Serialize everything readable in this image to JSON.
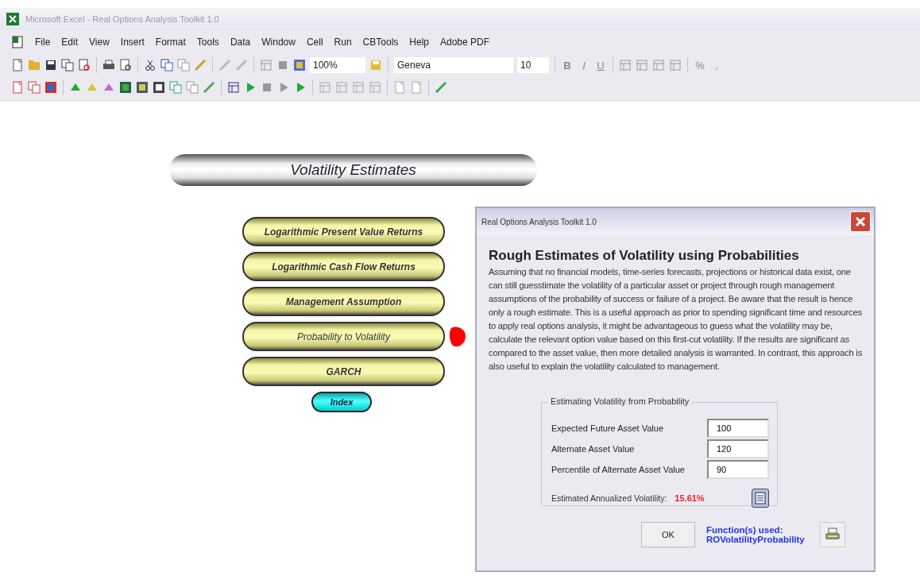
{
  "window": {
    "title": "Microsoft Excel - Real Options Analysis Toolkit 1.0"
  },
  "menu": [
    "File",
    "Edit",
    "View",
    "Insert",
    "Format",
    "Tools",
    "Data",
    "Window",
    "Cell",
    "Run",
    "CBTools",
    "Help",
    "Adobe PDF"
  ],
  "toolbar": {
    "zoom": "100%",
    "font": "Geneva",
    "font_size": "10",
    "format_buttons": [
      "B",
      "I",
      "U"
    ],
    "number_buttons": [
      "%",
      ","
    ]
  },
  "sheet": {
    "banner": "Volatility Estimates",
    "buttons": [
      {
        "label": "Logarithmic Present Value Returns",
        "selected": false
      },
      {
        "label": "Logarithmic Cash Flow Returns",
        "selected": false
      },
      {
        "label": "Management Assumption",
        "selected": false
      },
      {
        "label": "Probability to Volatility",
        "selected": true
      },
      {
        "label": "GARCH",
        "selected": false
      }
    ],
    "index_button": "Index"
  },
  "dialog": {
    "title": "Real Options Analysis Toolkit 1.0",
    "heading": "Rough Estimates of Volatility using Probabilities",
    "description": "Assuming that no financial models, time-series forecasts, projections or historical data exist, one can still guesstimate the volatility of a particular asset or project through rough management assumptions of the probability of success or failure of a project. Be aware that the result is hence only a rough estimate. This is a useful approach as prior to spending significant time and resources to apply real options analysis, it might be advantageous to guess what the volatility may be, calculate the relevant option value based on this first-cut volatility. If the results are significant as compared to the asset value, then more detailed analysis is warranted. In contrast, this approach is also useful to explain the volatility calculated to management.",
    "group": {
      "title": "Estimating Volatility from Probability",
      "fields": [
        {
          "label": "Expected Future Asset Value",
          "value": "100"
        },
        {
          "label": "Alternate Asset Value",
          "value": "120"
        },
        {
          "label": "Percentile of Alternate Asset Value",
          "value": "90"
        }
      ],
      "result_label": "Estimated Annualized Volatility:",
      "result_value": "15.61%"
    },
    "ok_button": "OK",
    "functions_label": "Function(s) used:",
    "function_name": "ROVolatilityProbability"
  }
}
